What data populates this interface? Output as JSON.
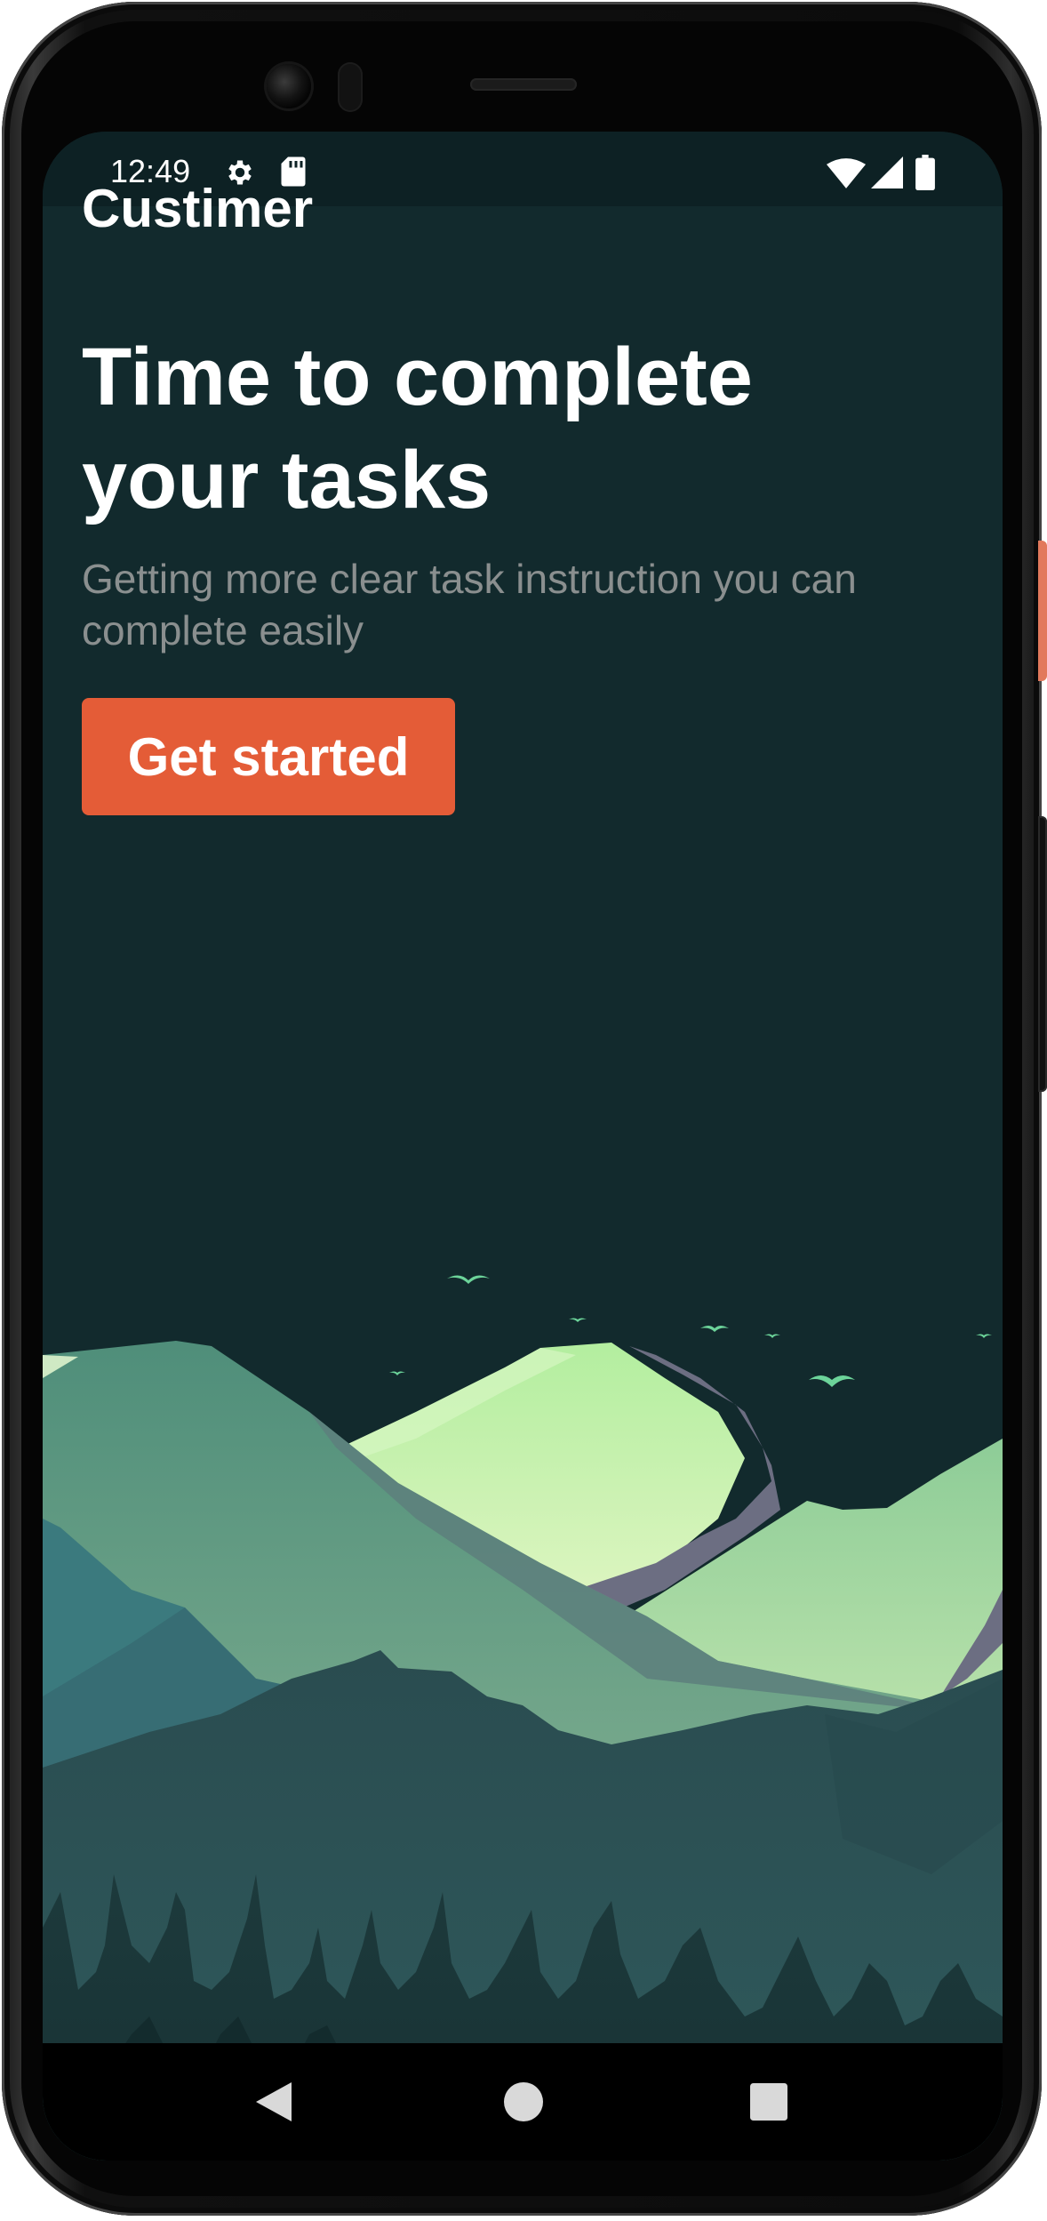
{
  "status_bar": {
    "time": "12:49",
    "icons": [
      "gear-icon",
      "sd-card-icon",
      "wifi-icon",
      "signal-icon",
      "battery-icon"
    ]
  },
  "app": {
    "name": "Custimer"
  },
  "hero": {
    "headline": "Time to complete your tasks",
    "subtitle": "Getting more clear task instruction you can complete easily",
    "cta_label": "Get started"
  },
  "illustration": {
    "name": "mountain-landscape",
    "colors": {
      "sky": "#122a2d",
      "peak_light": "#c9f0b0",
      "peak_mid": "#5e9f88",
      "ridge_grey": "#6c6e82",
      "forest_dark": "#1f3d40",
      "birds": "#6cd49a"
    }
  },
  "nav_bar": {
    "buttons": [
      "back-icon",
      "home-icon",
      "recents-icon"
    ]
  },
  "colors": {
    "background": "#122a2d",
    "accent": "#e45c37",
    "text_primary": "#ffffff",
    "text_secondary": "#8a8f8f"
  }
}
